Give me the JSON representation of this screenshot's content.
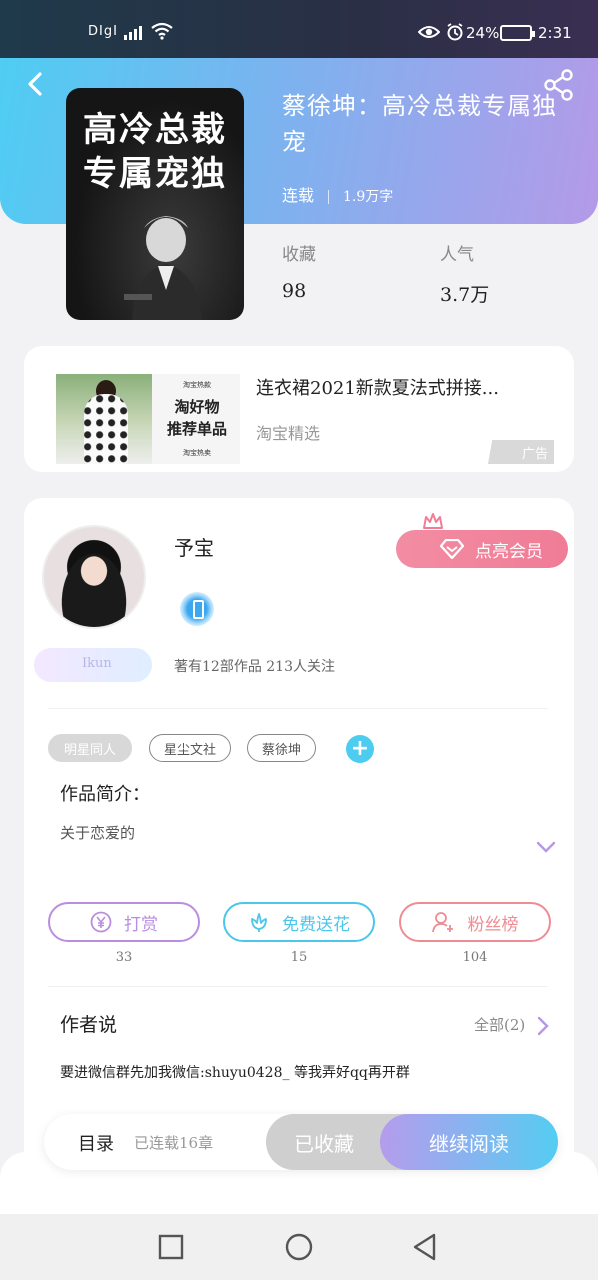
{
  "status_bar": {
    "carrier": "DIgI",
    "battery": "24%",
    "time": "2:31"
  },
  "book": {
    "cover_line1": "高冷总裁",
    "cover_line2": "专属宠独",
    "title": "蔡徐坤：高冷总裁专属独宠",
    "status": "连载",
    "word_count": "1.9万字",
    "favorites_label": "收藏",
    "favorites_value": "98",
    "popularity_label": "人气",
    "popularity_value": "3.7万"
  },
  "ad": {
    "image_top_small": "淘宝热款",
    "image_line1": "淘好物",
    "image_line2": "推荐单品",
    "image_bottom_small": "淘宝热卖",
    "title": "连衣裙2021新款夏法式拼接...",
    "source": "淘宝精选",
    "badge": "广告"
  },
  "author": {
    "name": "予宝",
    "fan_badge": "Ikun",
    "stats": "著有12部作品 213人关注",
    "vip_button": "点亮会员"
  },
  "tags": [
    "明星同人",
    "星尘文社",
    "蔡徐坤"
  ],
  "intro": {
    "label": "作品简介：",
    "text": "关于恋爱的"
  },
  "actions": [
    {
      "label": "打赏",
      "count": "33",
      "color": "#b98ee0"
    },
    {
      "label": "免费送花",
      "count": "15",
      "color": "#4cc6ea"
    },
    {
      "label": "粉丝榜",
      "count": "104",
      "color": "#ee8c94"
    }
  ],
  "author_says": {
    "label": "作者说",
    "all": "全部(2)",
    "text": "要进微信群先加我微信:shuyu0428_ 等我弄好qq再开群"
  },
  "bottom_bar": {
    "toc": "目录",
    "progress": "已连载16章",
    "collected": "已收藏",
    "continue": "继续阅读"
  },
  "colors": {
    "header_start": "#4fcdf3",
    "header_end": "#b49ae8",
    "accent_cyan": "#4ccdf0",
    "vip_pink": "#f07c96"
  }
}
